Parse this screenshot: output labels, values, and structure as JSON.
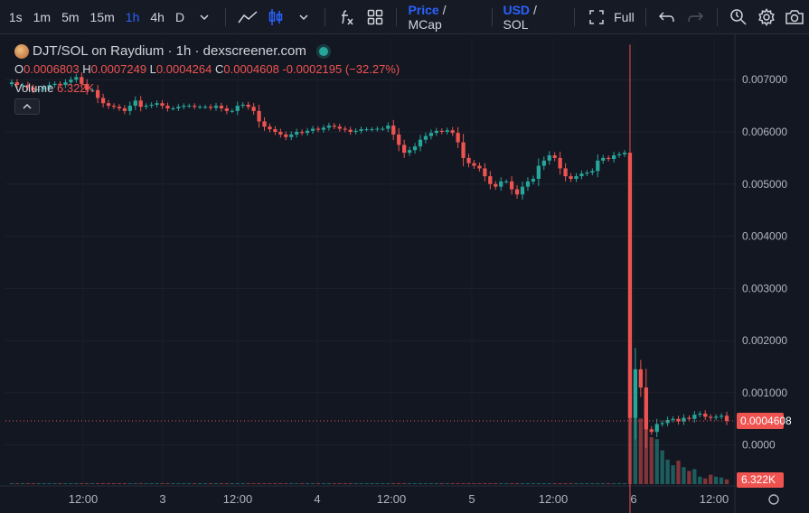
{
  "toolbar": {
    "timeframes": [
      "1s",
      "1m",
      "5m",
      "15m",
      "1h",
      "4h",
      "D"
    ],
    "active_timeframe": "1h",
    "price_label": "Price",
    "mcap_label": "/ MCap",
    "usd_label": "USD",
    "sol_label": "/ SOL",
    "full_label": "Full"
  },
  "legend": {
    "title": "DJT/SOL on Raydium · 1h · dexscreener.com",
    "o_key": "O",
    "o_val": "0.0006803",
    "h_key": "H",
    "h_val": "0.0007249",
    "l_key": "L",
    "l_val": "0.0004264",
    "c_key": "C",
    "c_val": "0.0004608",
    "change": "-0.0002195 (−32.27%)",
    "volume_label": "Volume",
    "volume_val": "6.322K"
  },
  "colors": {
    "up": "#26a69a",
    "down": "#ef5350",
    "accent": "#2962ff",
    "bg": "#131722"
  },
  "chart_data": {
    "type": "candlestick",
    "title": "DJT/SOL on Raydium · 1h · dexscreener.com",
    "y_ticks": [
      "0.007000",
      "0.006000",
      "0.005000",
      "0.004000",
      "0.003000",
      "0.002000",
      "0.001000",
      "0.0000"
    ],
    "ylim": [
      -0.00075,
      0.0078
    ],
    "x_ticks": [
      "12:00",
      "3",
      "12:00",
      "4",
      "12:00",
      "5",
      "12:00",
      "6",
      "12:00"
    ],
    "last_price_label": "0.0004608",
    "last_price": 0.0004608,
    "last_volume_label": "6.322K",
    "grid": true,
    "close_series": [
      0.00695,
      0.0069,
      0.0069,
      0.00685,
      0.0068,
      0.00682,
      0.00685,
      0.0069,
      0.00692,
      0.0069,
      0.00695,
      0.007,
      0.00705,
      0.00692,
      0.0068,
      0.0068,
      0.00665,
      0.00655,
      0.0065,
      0.00648,
      0.00645,
      0.0064,
      0.0065,
      0.0066,
      0.00648,
      0.0065,
      0.00652,
      0.00655,
      0.0065,
      0.00645,
      0.00645,
      0.00648,
      0.0065,
      0.0065,
      0.00648,
      0.00648,
      0.00648,
      0.00646,
      0.0065,
      0.00645,
      0.0064,
      0.0064,
      0.0065,
      0.00652,
      0.00648,
      0.0064,
      0.0062,
      0.0061,
      0.00605,
      0.006,
      0.00595,
      0.0059,
      0.00595,
      0.006,
      0.00598,
      0.00602,
      0.00606,
      0.00604,
      0.00608,
      0.00612,
      0.0061,
      0.00606,
      0.00604,
      0.006,
      0.00602,
      0.00605,
      0.00605,
      0.00605,
      0.00606,
      0.00606,
      0.00612,
      0.00595,
      0.00575,
      0.0056,
      0.00565,
      0.00572,
      0.00585,
      0.00592,
      0.00598,
      0.00602,
      0.006,
      0.00603,
      0.00598,
      0.0058,
      0.0055,
      0.0054,
      0.00535,
      0.0053,
      0.00515,
      0.005,
      0.00495,
      0.00505,
      0.00505,
      0.0049,
      0.0048,
      0.00495,
      0.00505,
      0.0051,
      0.00535,
      0.00545,
      0.00555,
      0.0055,
      0.0053,
      0.00515,
      0.0051,
      0.00515,
      0.0052,
      0.00522,
      0.00525,
      0.00545,
      0.0055,
      0.00548,
      0.00555,
      0.00557,
      0.0056,
      0.00052,
      0.00145,
      0.0011,
      0.0003,
      0.00025,
      0.0004,
      0.00042,
      0.00048,
      0.0005,
      0.00045,
      0.00052,
      0.0005,
      0.00058,
      0.0006,
      0.00054,
      0.00052,
      0.00054,
      0.00056,
      0.00046
    ],
    "volume_series": [
      1,
      1,
      1,
      1,
      1,
      1,
      1,
      1,
      1,
      1,
      1,
      1,
      1,
      1,
      1,
      1,
      1,
      1,
      1,
      1,
      1,
      1,
      1,
      1,
      1,
      1,
      1,
      1,
      1,
      1,
      1,
      1,
      1,
      1,
      1,
      1,
      1,
      1,
      1,
      1,
      1,
      1,
      1,
      1,
      1,
      1,
      1,
      1,
      1,
      1,
      1,
      1,
      1,
      1,
      1,
      1,
      1,
      1,
      1,
      1,
      1,
      1,
      1,
      1,
      1,
      1,
      1,
      1,
      1,
      1,
      1,
      1,
      1,
      1,
      1,
      1,
      1,
      1,
      1,
      1,
      1,
      1,
      1,
      1,
      1,
      1,
      1,
      1,
      1,
      1,
      1,
      1,
      1,
      1,
      1,
      1,
      1,
      1,
      1,
      1,
      1,
      1,
      1,
      1,
      1,
      1,
      1,
      1,
      1,
      1,
      1,
      1,
      1,
      1,
      1,
      130,
      110,
      70,
      80,
      50,
      48,
      36,
      26,
      20,
      25,
      18,
      14,
      16,
      8,
      6,
      10,
      8,
      7,
      5
    ]
  }
}
